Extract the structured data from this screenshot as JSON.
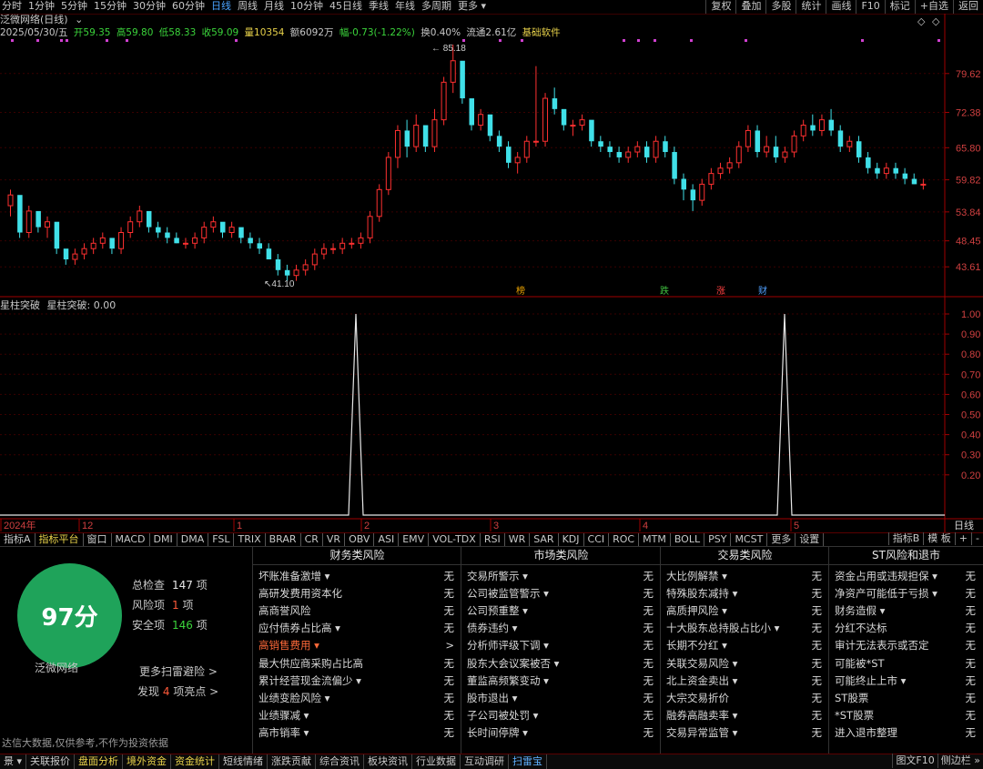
{
  "toolbar": {
    "periods": [
      "分时",
      "1分钟",
      "5分钟",
      "15分钟",
      "30分钟",
      "60分钟",
      "日线",
      "周线",
      "月线",
      "10分钟",
      "45日线",
      "季线",
      "年线",
      "多周期",
      "更多 ▾"
    ],
    "active_period": "日线",
    "right_tools": [
      "复权",
      "叠加",
      "多股",
      "统计",
      "画线",
      "F10",
      "标记",
      "+自选",
      "返回"
    ]
  },
  "stock": {
    "title": "泛微网络(日线)",
    "date": "2025/05/30/五",
    "open": "开59.35",
    "high": "高59.80",
    "low": "低58.33",
    "close": "收59.09",
    "volume": "量10354",
    "amount": "额6092万",
    "change": "幅-0.73(-1.22%)",
    "turnover": "换0.40%",
    "float_cap": "流通2.61亿",
    "sector": "基础软件"
  },
  "chart_data": {
    "type": "candlestick",
    "y_ticks": [
      "79.62",
      "72.38",
      "65.80",
      "59.82",
      "53.84",
      "48.45",
      "43.61"
    ],
    "max_label": "85.18",
    "min_label": "41.10",
    "event_tags": [
      "榜",
      "跌",
      "涨",
      "财"
    ],
    "x_labels": [
      "2024年",
      "12",
      "1",
      "2",
      "3",
      "4",
      "5"
    ],
    "axis_corner": "日线",
    "indicator": {
      "name": "星柱突破",
      "value_label": "星柱突破: 0.00",
      "y_ticks": [
        "1.00",
        "0.90",
        "0.80",
        "0.70",
        "0.60",
        "0.50",
        "0.40",
        "0.30",
        "0.20"
      ],
      "spikes": [
        1.0,
        1.0
      ]
    },
    "candles": [
      [
        55,
        58,
        53,
        57
      ],
      [
        57,
        56,
        49,
        50
      ],
      [
        50,
        55,
        49,
        54
      ],
      [
        54,
        53,
        50,
        51
      ],
      [
        51,
        53,
        49,
        52
      ],
      [
        52,
        51,
        46,
        47
      ],
      [
        47,
        46,
        44,
        45
      ],
      [
        45,
        47,
        44,
        46
      ],
      [
        46,
        48,
        45,
        47
      ],
      [
        47,
        49,
        46,
        48
      ],
      [
        48,
        50,
        47,
        49
      ],
      [
        49,
        47,
        46,
        47
      ],
      [
        47,
        51,
        46,
        50
      ],
      [
        50,
        53,
        49,
        52
      ],
      [
        52,
        55,
        51,
        54
      ],
      [
        54,
        53,
        50,
        51
      ],
      [
        51,
        52,
        49,
        50
      ],
      [
        50,
        51,
        48,
        49
      ],
      [
        49,
        50,
        48,
        48
      ],
      [
        48,
        49,
        47,
        48
      ],
      [
        48,
        50,
        47,
        49
      ],
      [
        49,
        52,
        48,
        51
      ],
      [
        51,
        53,
        50,
        52
      ],
      [
        52,
        51,
        49,
        50
      ],
      [
        50,
        52,
        49,
        51
      ],
      [
        51,
        50,
        48,
        49
      ],
      [
        49,
        50,
        47,
        48
      ],
      [
        48,
        49,
        46,
        47
      ],
      [
        47,
        48,
        45,
        45
      ],
      [
        45,
        46,
        42,
        43
      ],
      [
        43,
        44,
        41,
        42
      ],
      [
        42,
        44,
        41,
        43
      ],
      [
        43,
        45,
        42,
        44
      ],
      [
        44,
        47,
        43,
        46
      ],
      [
        46,
        48,
        45,
        47
      ],
      [
        47,
        48,
        46,
        47
      ],
      [
        47,
        49,
        46,
        48
      ],
      [
        48,
        49,
        47,
        48
      ],
      [
        48,
        50,
        47,
        49
      ],
      [
        49,
        54,
        48,
        53
      ],
      [
        53,
        59,
        52,
        58
      ],
      [
        58,
        65,
        57,
        64
      ],
      [
        64,
        70,
        62,
        69
      ],
      [
        69,
        71,
        64,
        66
      ],
      [
        66,
        72,
        65,
        70
      ],
      [
        70,
        69,
        65,
        66
      ],
      [
        66,
        73,
        65,
        71
      ],
      [
        71,
        79,
        70,
        78
      ],
      [
        78,
        85,
        76,
        82
      ],
      [
        82,
        80,
        74,
        75
      ],
      [
        75,
        74,
        69,
        70
      ],
      [
        70,
        73,
        69,
        72
      ],
      [
        72,
        71,
        67,
        68
      ],
      [
        68,
        69,
        65,
        66
      ],
      [
        66,
        67,
        62,
        63
      ],
      [
        63,
        65,
        61,
        64
      ],
      [
        64,
        68,
        63,
        67
      ],
      [
        67,
        81,
        66,
        67
      ],
      [
        67,
        76,
        66,
        75
      ],
      [
        75,
        77,
        72,
        73
      ],
      [
        73,
        72,
        69,
        70
      ],
      [
        70,
        71,
        68,
        70
      ],
      [
        70,
        72,
        69,
        71
      ],
      [
        71,
        70,
        66,
        67
      ],
      [
        67,
        68,
        65,
        66
      ],
      [
        66,
        67,
        64,
        65
      ],
      [
        65,
        66,
        63,
        64
      ],
      [
        64,
        66,
        63,
        65
      ],
      [
        65,
        67,
        64,
        66
      ],
      [
        66,
        67,
        63,
        64
      ],
      [
        64,
        68,
        63,
        67
      ],
      [
        67,
        68,
        64,
        65
      ],
      [
        65,
        66,
        59,
        60
      ],
      [
        60,
        61,
        56,
        58
      ],
      [
        58,
        59,
        54,
        56
      ],
      [
        56,
        60,
        55,
        59
      ],
      [
        59,
        62,
        58,
        61
      ],
      [
        61,
        63,
        60,
        62
      ],
      [
        62,
        64,
        61,
        63
      ],
      [
        63,
        67,
        62,
        66
      ],
      [
        66,
        70,
        65,
        69
      ],
      [
        69,
        70,
        64,
        65
      ],
      [
        65,
        68,
        64,
        66
      ],
      [
        66,
        68,
        63,
        64
      ],
      [
        64,
        66,
        63,
        65
      ],
      [
        65,
        69,
        64,
        68
      ],
      [
        68,
        71,
        67,
        70
      ],
      [
        70,
        72,
        68,
        69
      ],
      [
        69,
        72,
        68,
        71
      ],
      [
        71,
        73,
        68,
        69
      ],
      [
        69,
        70,
        65,
        66
      ],
      [
        66,
        68,
        65,
        67
      ],
      [
        67,
        68,
        63,
        64
      ],
      [
        64,
        65,
        61,
        62
      ],
      [
        62,
        63,
        60,
        61
      ],
      [
        61,
        63,
        60,
        62
      ],
      [
        62,
        63,
        60,
        61
      ],
      [
        61,
        62,
        59,
        60
      ],
      [
        60,
        61,
        59,
        59
      ],
      [
        59,
        60,
        58,
        59
      ]
    ]
  },
  "tabs": [
    "指标A",
    "指标平台",
    "窗口",
    "MACD",
    "DMI",
    "DMA",
    "FSL",
    "TRIX",
    "BRAR",
    "CR",
    "VR",
    "OBV",
    "ASI",
    "EMV",
    "VOL-TDX",
    "RSI",
    "WR",
    "SAR",
    "KDJ",
    "CCI",
    "ROC",
    "MTM",
    "BOLL",
    "PSY",
    "MCST",
    "更多",
    "设置"
  ],
  "tabs_right": [
    "指标B",
    "模 板",
    "+",
    "-"
  ],
  "panel": {
    "score": "97分",
    "stock_name": "泛微网络",
    "total_label": "总检查",
    "total_value": "147",
    "total_unit": "项",
    "risk_label": "风险项",
    "risk_value": "1",
    "risk_unit": "项",
    "safe_label": "安全项",
    "safe_value": "146",
    "safe_unit": "项",
    "more_scan": "更多扫雷避险 >",
    "discover_pre": "发现",
    "discover_num": "4",
    "discover_post": "项亮点 >",
    "disclaimer": "达信大数据,仅供参考,不作为投资依据",
    "columns": [
      {
        "title": "财务类风险",
        "items": [
          {
            "label": "坏账准备激增 ▾",
            "value": "无"
          },
          {
            "label": "高研发费用资本化",
            "value": "无"
          },
          {
            "label": "高商誉风险",
            "value": "无"
          },
          {
            "label": "应付债券占比高 ▾",
            "value": "无"
          },
          {
            "label": "高销售费用 ▾",
            "value": ">",
            "warn": true
          },
          {
            "label": "最大供应商采购占比高",
            "value": "无"
          },
          {
            "label": "累计经营现金流偏少 ▾",
            "value": "无"
          },
          {
            "label": "业绩变脸风险 ▾",
            "value": "无"
          },
          {
            "label": "业绩骤减 ▾",
            "value": "无"
          },
          {
            "label": "高市销率 ▾",
            "value": "无"
          }
        ]
      },
      {
        "title": "市场类风险",
        "items": [
          {
            "label": "交易所警示 ▾",
            "value": "无"
          },
          {
            "label": "公司被监管警示 ▾",
            "value": "无"
          },
          {
            "label": "公司预重整 ▾",
            "value": "无"
          },
          {
            "label": "债券违约 ▾",
            "value": "无"
          },
          {
            "label": "分析师评级下调 ▾",
            "value": "无"
          },
          {
            "label": "股东大会议案被否 ▾",
            "value": "无"
          },
          {
            "label": "董监高频繁变动 ▾",
            "value": "无"
          },
          {
            "label": "股市退出 ▾",
            "value": "无"
          },
          {
            "label": "子公司被处罚 ▾",
            "value": "无"
          },
          {
            "label": "长时间停牌 ▾",
            "value": "无"
          }
        ]
      },
      {
        "title": "交易类风险",
        "items": [
          {
            "label": "大比例解禁 ▾",
            "value": "无"
          },
          {
            "label": "特殊股东减持 ▾",
            "value": "无"
          },
          {
            "label": "高质押风险 ▾",
            "value": "无"
          },
          {
            "label": "十大股东总持股占比小 ▾",
            "value": "无"
          },
          {
            "label": "长期不分红 ▾",
            "value": "无"
          },
          {
            "label": "关联交易风险 ▾",
            "value": "无"
          },
          {
            "label": "北上资金卖出 ▾",
            "value": "无"
          },
          {
            "label": "大宗交易折价",
            "value": "无"
          },
          {
            "label": "融券高融卖率 ▾",
            "value": "无"
          },
          {
            "label": "交易异常监管 ▾",
            "value": "无"
          }
        ]
      },
      {
        "title": "ST风险和退市",
        "items": [
          {
            "label": "资金占用或违规担保 ▾",
            "value": "无"
          },
          {
            "label": "净资产可能低于亏损 ▾",
            "value": "无"
          },
          {
            "label": "财务造假 ▾",
            "value": "无"
          },
          {
            "label": "分红不达标",
            "value": "无"
          },
          {
            "label": "审计无法表示或否定",
            "value": "无"
          },
          {
            "label": "可能被*ST",
            "value": "无"
          },
          {
            "label": "可能终止上市 ▾",
            "value": "无"
          },
          {
            "label": "ST股票",
            "value": "无"
          },
          {
            "label": "*ST股票",
            "value": "无"
          },
          {
            "label": "进入退市整理",
            "value": "无"
          }
        ]
      }
    ]
  },
  "statusbar": {
    "items": [
      "景 ▾",
      "关联报价",
      "盘面分析",
      "境外资金",
      "资金统计",
      "短线情绪",
      "涨跌贡献",
      "综合资讯",
      "板块资讯",
      "行业数据",
      "互动调研",
      "扫雷宝"
    ],
    "right": [
      "图文F10",
      "侧边栏 »"
    ]
  }
}
